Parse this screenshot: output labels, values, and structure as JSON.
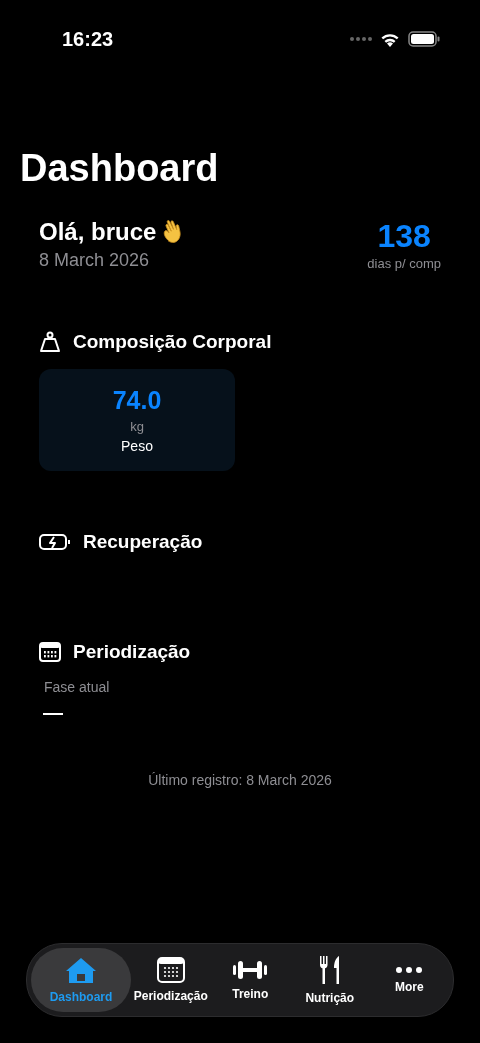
{
  "status_bar": {
    "time": "16:23"
  },
  "title": "Dashboard",
  "greeting": {
    "text": "Olá, bruce",
    "date": "8 March 2026",
    "countdown": "138",
    "countdown_label": "dias p/ comp"
  },
  "sections": [
    {
      "kind": "body",
      "title": "Composição Corporal",
      "metrics": [
        {
          "value": "74.0",
          "unit": "kg",
          "label": "Peso"
        }
      ]
    },
    {
      "kind": "recovery",
      "title": "Recuperação"
    },
    {
      "kind": "period",
      "title": "Periodização",
      "phase_label": "Fase atual",
      "phase_value": "—"
    }
  ],
  "last_record": "Último registro: 8 March 2026",
  "tabs": [
    {
      "kind": "home",
      "label": "Dashboard",
      "selected": true
    },
    {
      "kind": "calendar",
      "label": "Periodização",
      "selected": false
    },
    {
      "kind": "dumbbell",
      "label": "Treino",
      "selected": false
    },
    {
      "kind": "food",
      "label": "Nutrição",
      "selected": false
    },
    {
      "kind": "more",
      "label": "More",
      "selected": false
    }
  ]
}
